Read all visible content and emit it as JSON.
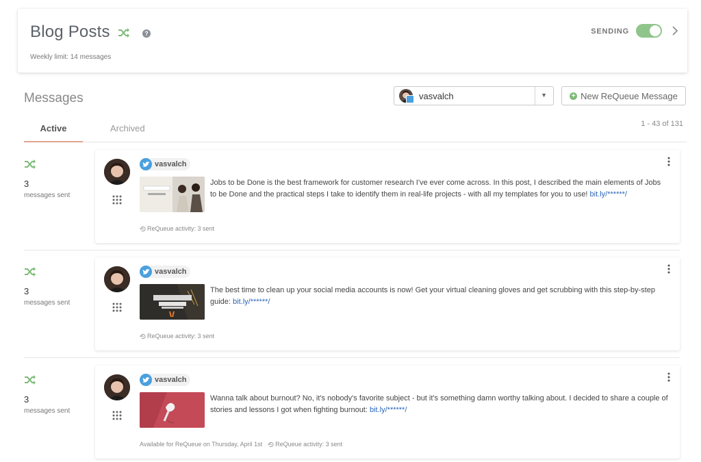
{
  "header": {
    "title": "Blog Posts",
    "help_glyph": "?",
    "weekly_limit": "Weekly limit: 14 messages",
    "sending_label": "SENDING",
    "sending_on": true
  },
  "messages": {
    "heading": "Messages",
    "account_select": {
      "value": "vasvalch"
    },
    "new_button_label": "New ReQueue Message",
    "tabs": [
      {
        "label": "Active",
        "active": true
      },
      {
        "label": "Archived",
        "active": false
      }
    ],
    "pagination": "1 - 43 of 131"
  },
  "rows": [
    {
      "count": "3",
      "sent_label": "messages sent",
      "account": "vasvalch",
      "text": "Jobs to be Done is the best framework for customer research I've ever come across. In this post, I described the main elements of Jobs to be Done and the practical steps I take to identify them in real-life projects - with all my templates for you to use! ",
      "link": "bit.ly/******/",
      "availability": "",
      "activity": "ReQueue activity: 3 sent"
    },
    {
      "count": "3",
      "sent_label": "messages sent",
      "account": "vasvalch",
      "text": "The best time to clean up your social media accounts is now! Get your virtual cleaning gloves and get scrubbing with this step-by-step guide: ",
      "link": "bit.ly/******/",
      "availability": "",
      "activity": "ReQueue activity: 3 sent"
    },
    {
      "count": "3",
      "sent_label": "messages sent",
      "account": "vasvalch",
      "text": "Wanna talk about burnout? No, it's nobody's favorite subject - but it's something damn worthy talking about. I decided to share a couple of stories and lessons I got when fighting burnout: ",
      "link": "bit.ly/******/",
      "availability": "Available for ReQueue on Thursday, April 1st",
      "activity": "ReQueue activity: 3 sent"
    }
  ],
  "colors": {
    "accent_green": "#7dbb78",
    "twitter_blue": "#4aa0de",
    "link_blue": "#2b66b8",
    "tab_underline": "#e0a58c"
  }
}
